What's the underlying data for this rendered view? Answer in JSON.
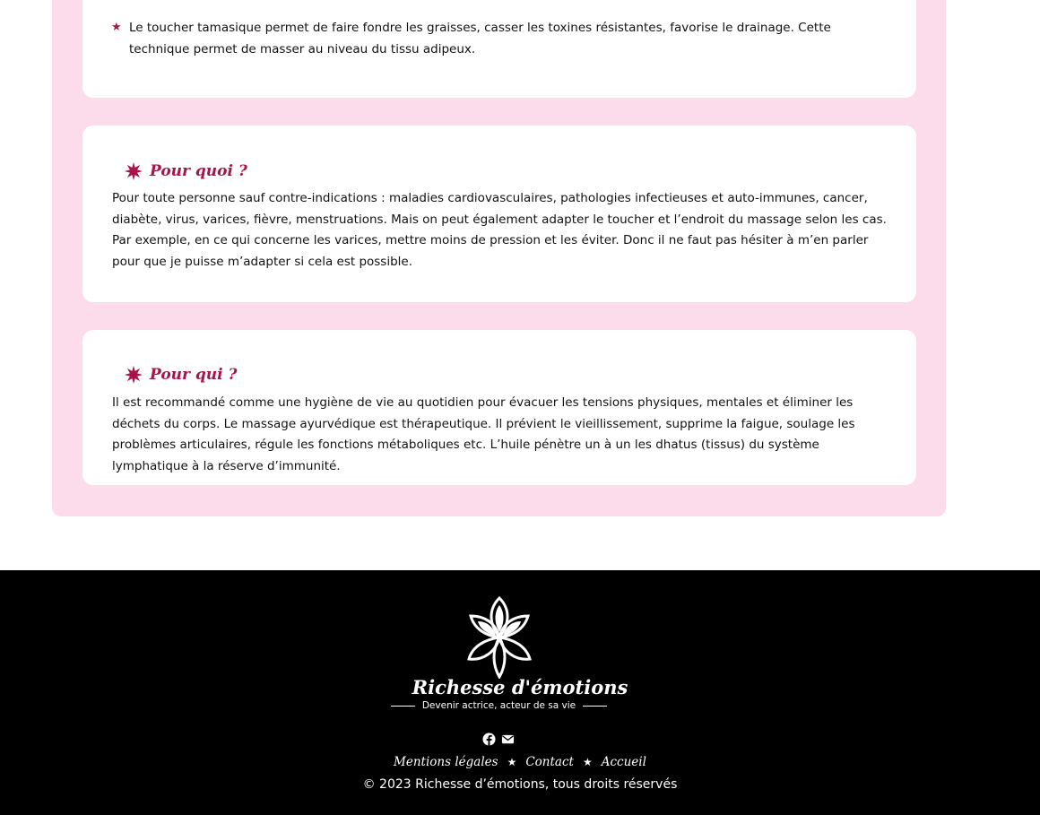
{
  "cards": [
    {
      "bullet": "Le toucher tamasique permet de faire fondre les graisses, casser les toxines résistantes, favorise le drainage. Cette technique permet de masser au niveau du tissu adipeux."
    },
    {
      "title": "Pour quoi ?",
      "text": "Pour toute personne sauf contre-indications : maladies cardiovasculaires, pathologies infectieuses et auto-immunes, cancer, diabète, virus, varices, fièvre, menstruations. Mais on peut également adapter le toucher et l’endroit du massage selon les cas. Par exemple, en ce qui concerne les varices, mettre moins de pression et les éviter. Donc il ne faut pas hésiter à m’en parler pour que je puisse m’adapter si cela est possible."
    },
    {
      "title": "Pour qui ?",
      "text": "Il est recommandé comme une hygiène de vie au quotidien pour évacuer les tensions physiques, mentales et éliminer les déchets du corps. Le massage ayurvédique est thérapeutique. Il prévient le vieillissement, supprime la faigue, soulage les problèmes articulaires, régule les fonctions métaboliques etc. L’huile pénètre un à un les dhatus (tissus) du système lymphatique à la réserve d’immunité."
    }
  ],
  "footer": {
    "brand": "Richesse d'émotions",
    "tagline": "Devenir actrice, acteur de sa vie",
    "social_icons": [
      "facebook-icon",
      "envelope-icon"
    ],
    "links": [
      "Mentions légales",
      "Contact",
      "Accueil"
    ],
    "copyright": "© 2023 Richesse d’émotions, tous droits réservés"
  },
  "colors": {
    "accent": "#a8134c",
    "pink_background": "#fcdbea",
    "footer_background": "#000000"
  }
}
